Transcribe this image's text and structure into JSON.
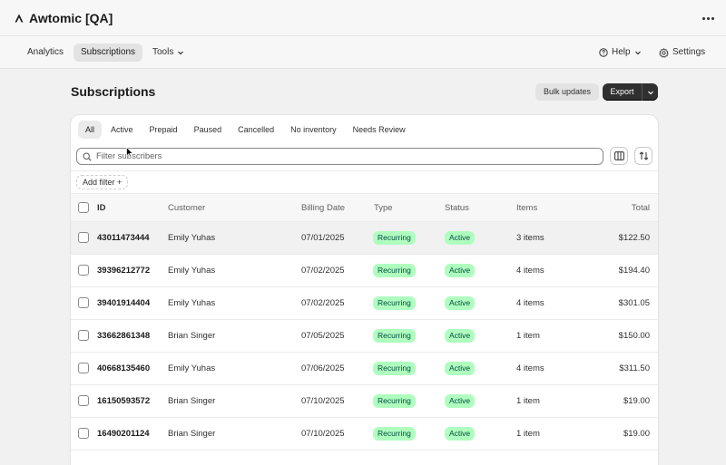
{
  "app": {
    "title": "Awtomic [QA]"
  },
  "nav": {
    "items": [
      {
        "label": "Analytics"
      },
      {
        "label": "Subscriptions"
      },
      {
        "label": "Tools"
      }
    ],
    "help_label": "Help",
    "settings_label": "Settings"
  },
  "page": {
    "title": "Subscriptions",
    "bulk_updates_label": "Bulk updates",
    "export_label": "Export"
  },
  "tabs": [
    "All",
    "Active",
    "Prepaid",
    "Paused",
    "Cancelled",
    "No inventory",
    "Needs Review"
  ],
  "search": {
    "placeholder": "Filter subscribers"
  },
  "add_filter_label": "Add filter +",
  "table": {
    "columns": {
      "id": "ID",
      "customer": "Customer",
      "billing_date": "Billing Date",
      "type": "Type",
      "status": "Status",
      "items": "Items",
      "total": "Total"
    },
    "rows": [
      {
        "id": "43011473444",
        "customer": "Emily Yuhas",
        "billing_date": "07/01/2025",
        "type": "Recurring",
        "status": "Active",
        "items": "3 items",
        "total": "$122.50"
      },
      {
        "id": "39396212772",
        "customer": "Emily Yuhas",
        "billing_date": "07/02/2025",
        "type": "Recurring",
        "status": "Active",
        "items": "4 items",
        "total": "$194.40"
      },
      {
        "id": "39401914404",
        "customer": "Emily Yuhas",
        "billing_date": "07/02/2025",
        "type": "Recurring",
        "status": "Active",
        "items": "4 items",
        "total": "$301.05"
      },
      {
        "id": "33662861348",
        "customer": "Brian Singer",
        "billing_date": "07/05/2025",
        "type": "Recurring",
        "status": "Active",
        "items": "1 item",
        "total": "$150.00"
      },
      {
        "id": "40668135460",
        "customer": "Emily Yuhas",
        "billing_date": "07/06/2025",
        "type": "Recurring",
        "status": "Active",
        "items": "4 items",
        "total": "$311.50"
      },
      {
        "id": "16150593572",
        "customer": "Brian Singer",
        "billing_date": "07/10/2025",
        "type": "Recurring",
        "status": "Active",
        "items": "1 item",
        "total": "$19.00"
      },
      {
        "id": "16490201124",
        "customer": "Brian Singer",
        "billing_date": "07/10/2025",
        "type": "Recurring",
        "status": "Active",
        "items": "1 item",
        "total": "$19.00"
      }
    ]
  },
  "colors": {
    "badge_bg": "#affebf",
    "badge_text": "#014b40",
    "export_bg": "#303030"
  }
}
